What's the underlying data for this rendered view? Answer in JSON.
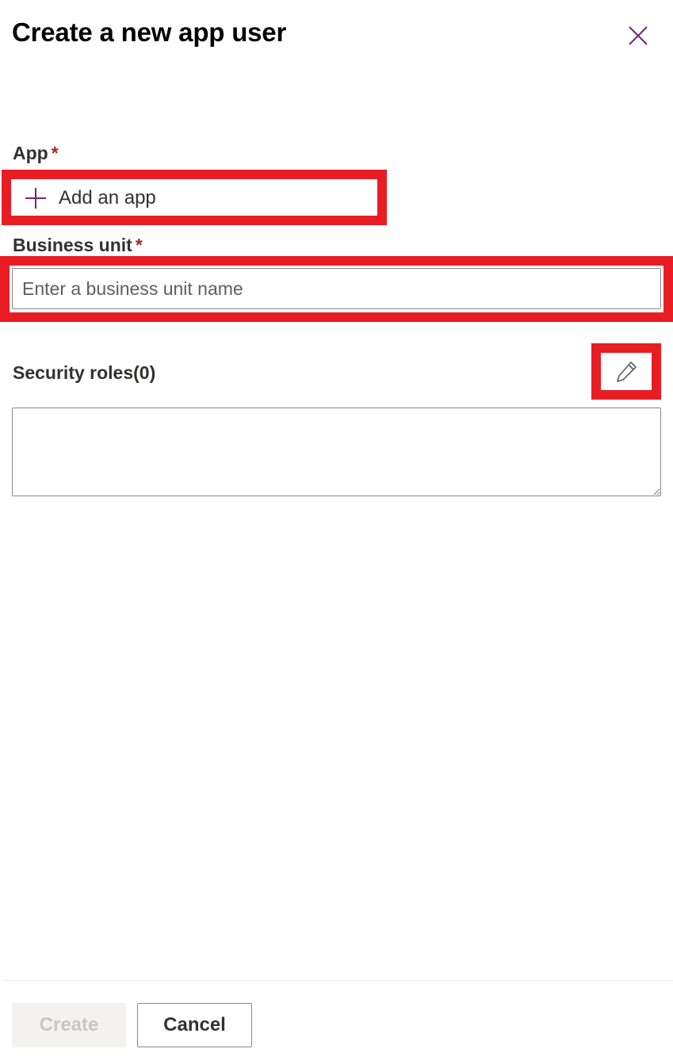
{
  "dialog": {
    "title": "Create a new app user",
    "close_icon": "close-icon"
  },
  "app_field": {
    "label": "App",
    "required_marker": "*",
    "add_button_label": "Add an app",
    "add_icon": "plus-icon"
  },
  "business_unit_field": {
    "label": "Business unit",
    "required_marker": "*",
    "value": "",
    "placeholder": "Enter a business unit name"
  },
  "security_roles": {
    "label": "Security roles(0)",
    "edit_icon": "pencil-icon",
    "value": ""
  },
  "footer": {
    "create_label": "Create",
    "cancel_label": "Cancel"
  },
  "colors": {
    "accent": "#742774",
    "highlight": "#e81c23",
    "required": "#a4262c"
  }
}
